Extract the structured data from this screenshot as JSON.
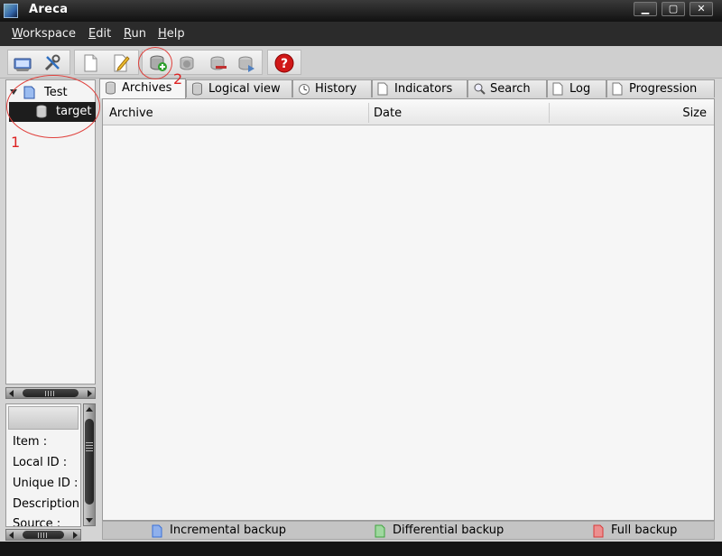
{
  "window": {
    "title": "Areca"
  },
  "menu": [
    "Workspace",
    "Edit",
    "Run",
    "Help"
  ],
  "toolbar": {
    "buttons": [
      "open-workspace",
      "preferences",
      "new-target-group",
      "edit",
      "backup",
      "merge",
      "delete-archive",
      "recover",
      "help"
    ]
  },
  "tree": {
    "group": "Test",
    "target": "target"
  },
  "properties": {
    "labels": [
      "Item :",
      "Local ID :",
      "Unique ID :",
      "Description :",
      "Source :"
    ]
  },
  "tabs": [
    "Archives",
    "Logical view",
    "History",
    "Indicators",
    "Search",
    "Log",
    "Progression"
  ],
  "active_tab": "Archives",
  "table": {
    "columns": [
      "Archive",
      "Date",
      "Size"
    ],
    "rows": []
  },
  "legend": [
    "Incremental backup",
    "Differential backup",
    "Full backup"
  ],
  "annotations": [
    "1",
    "2"
  ],
  "colors": {
    "annotation": "#e0403c",
    "incremental": "#3a6fd8",
    "differential": "#3fa33f",
    "full": "#d83a3a",
    "backup_plus": "#2ea02e",
    "help": "#d01818"
  }
}
